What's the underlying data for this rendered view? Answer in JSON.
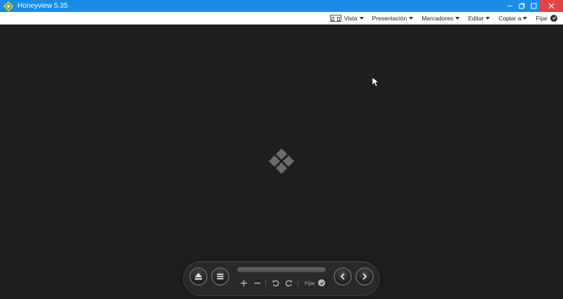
{
  "window": {
    "title": "Honeyview 5.35",
    "controls": [
      "minimize-icon",
      "restore-icon",
      "close-icon"
    ],
    "titlebar_color": "#1a8ce8",
    "close_color": "#e04343"
  },
  "menu": {
    "items": [
      {
        "label": "Vista",
        "icon": "view-icon"
      },
      {
        "label": "Presentación"
      },
      {
        "label": "Marcadores"
      },
      {
        "label": "Editar"
      },
      {
        "label": "Copiar a"
      }
    ],
    "pin_label": "Fijar",
    "pin_icon": "check-circle-icon"
  },
  "viewer": {
    "background": "#1e1e1e",
    "center_icon": "honeyview-logo-icon"
  },
  "toolbar": {
    "buttons": [
      "eject-icon",
      "menu-icon"
    ],
    "tools": [
      "zoom-in-icon",
      "zoom-out-icon",
      "rotate-left-icon",
      "rotate-right-icon"
    ],
    "pin_label": "Fijar",
    "nav": [
      "previous-icon",
      "next-icon"
    ]
  }
}
